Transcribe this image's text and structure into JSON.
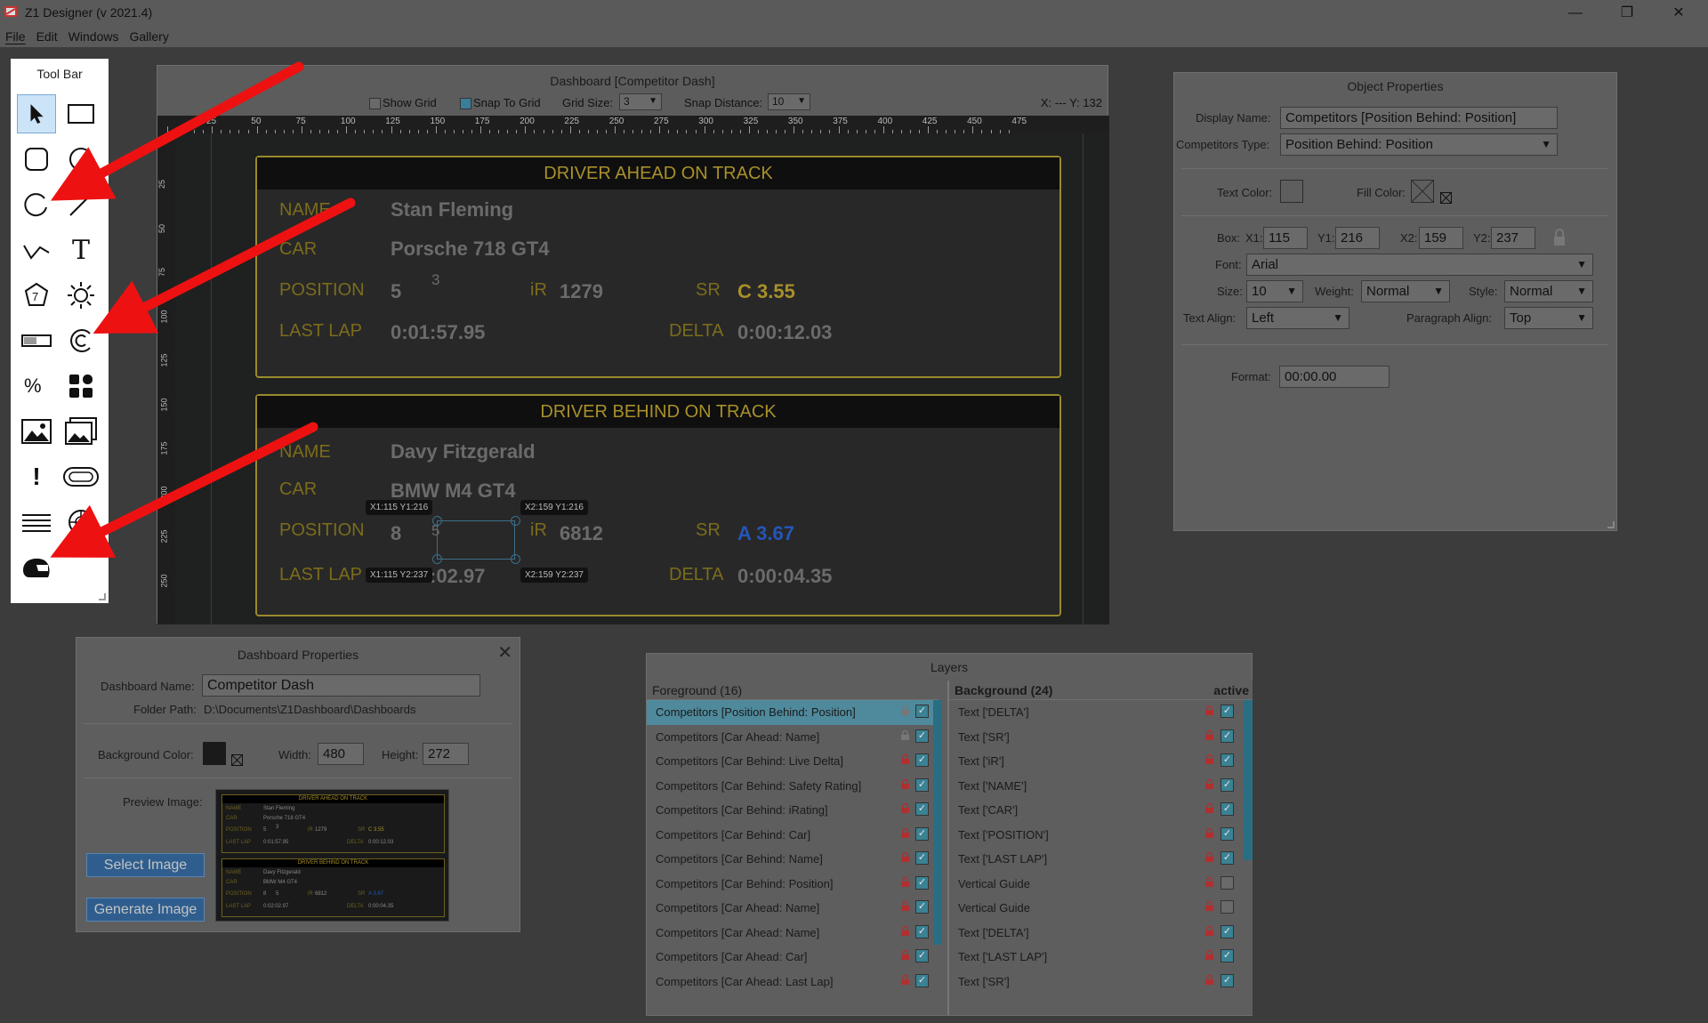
{
  "window": {
    "title": "Z1 Designer (v 2021.4)",
    "min": "—",
    "restore": "❐",
    "close": "✕"
  },
  "menu": [
    "File",
    "Edit",
    "Windows",
    "Gallery"
  ],
  "toolbar": {
    "title": "Tool Bar"
  },
  "dashboard": {
    "title": "Dashboard [Competitor Dash]",
    "show_grid": "Show Grid",
    "snap_to_grid": "Snap To Grid",
    "grid_size_label": "Grid Size:",
    "grid_size": "3",
    "snap_distance_label": "Snap Distance:",
    "snap_distance": "10",
    "coords": "X: --- Y: 132",
    "ruler_ticks": [
      "25",
      "50",
      "75",
      "100",
      "125",
      "150",
      "175",
      "200",
      "225",
      "250",
      "275",
      "300",
      "325",
      "350",
      "375",
      "400",
      "425",
      "450",
      "475"
    ],
    "vruler_ticks": [
      "25",
      "50",
      "75",
      "100",
      "125",
      "150",
      "175",
      "200",
      "225",
      "250"
    ],
    "ahead": {
      "header": "DRIVER AHEAD ON TRACK",
      "name_label": "NAME",
      "name": "Stan Fleming",
      "car_label": "CAR",
      "car": "Porsche 718 GT4",
      "position_label": "POSITION",
      "position": "5",
      "class_pos": "3",
      "ir_label": "iR",
      "ir": "1279",
      "sr_label": "SR",
      "sr": "C 3.55",
      "lastlap_label": "LAST LAP",
      "lastlap": "0:01:57.95",
      "delta_label": "DELTA",
      "delta": "0:00:12.03"
    },
    "behind": {
      "header": "DRIVER BEHIND ON TRACK",
      "name_label": "NAME",
      "name": "Davy Fitzgerald",
      "car_label": "CAR",
      "car": "BMW M4 GT4",
      "position_label": "POSITION",
      "position": "8",
      "class_pos": "5",
      "ir_label": "iR",
      "ir": "6812",
      "sr_label": "SR",
      "sr": "A 3.67",
      "lastlap_label": "LAST LAP",
      "lastlap": "0:02:02.97",
      "delta_label": "DELTA",
      "delta": "0:00:04.35"
    },
    "badges": {
      "tl": "X1:115 Y1:216",
      "tr": "X2:159 Y1:216",
      "bl": "X1:115 Y2:237",
      "br": "X2:159 Y2:237"
    }
  },
  "object_props": {
    "title": "Object Properties",
    "display_name_label": "Display Name:",
    "display_name": "Competitors [Position Behind: Position]",
    "type_label": "Competitors Type:",
    "type": "Position Behind: Position",
    "text_color_label": "Text Color:",
    "fill_color_label": "Fill Color:",
    "box_label": "Box:",
    "x1_label": "X1:",
    "x1": "115",
    "y1_label": "Y1:",
    "y1": "216",
    "x2_label": "X2:",
    "x2": "159",
    "y2_label": "Y2:",
    "y2": "237",
    "font_label": "Font:",
    "font": "Arial",
    "size_label": "Size:",
    "size": "10",
    "weight_label": "Weight:",
    "weight": "Normal",
    "style_label": "Style:",
    "style": "Normal",
    "text_align_label": "Text Align:",
    "text_align": "Left",
    "para_align_label": "Paragraph Align:",
    "para_align": "Top",
    "format_label": "Format:",
    "format": "00:00.00"
  },
  "dash_props": {
    "title": "Dashboard Properties",
    "name_label": "Dashboard Name:",
    "name": "Competitor Dash",
    "folder_label": "Folder Path:",
    "folder": "D:\\Documents\\Z1Dashboard\\Dashboards",
    "bg_label": "Background Color:",
    "width_label": "Width:",
    "width": "480",
    "height_label": "Height:",
    "height": "272",
    "preview_label": "Preview Image:",
    "select_btn": "Select Image",
    "generate_btn": "Generate Image",
    "preview": {
      "h1": "DRIVER AHEAD ON TRACK",
      "h2": "DRIVER BEHIND ON TRACK",
      "r1": [
        "NAME",
        "Stan Fleming"
      ],
      "r2": [
        "CAR",
        "Porsche 718 GT4"
      ],
      "r3": [
        "POSITION",
        "5",
        "3",
        "iR",
        "1279",
        "SR",
        "C 3.55"
      ],
      "r4": [
        "LAST LAP",
        "0:01:57.95",
        "DELTA",
        "0:00:12.03"
      ],
      "s1": [
        "NAME",
        "Davy Fitzgerald"
      ],
      "s2": [
        "CAR",
        "BMW M4 GT4"
      ],
      "s3": [
        "POSITION",
        "8",
        "5",
        "iR",
        "6812",
        "SR",
        "A 3.67"
      ],
      "s4": [
        "LAST LAP",
        "0:02:02.97",
        "DELTA",
        "0:00:04.35"
      ]
    }
  },
  "layers": {
    "title": "Layers",
    "fg_label": "Foreground (16)",
    "bg_label": "Background (24)",
    "active_label": "active",
    "foreground": [
      {
        "name": "Competitors [Position Behind: Position]",
        "locked": false,
        "checked": true,
        "selected": true
      },
      {
        "name": "Competitors [Car Ahead: Name]",
        "locked": false,
        "checked": true
      },
      {
        "name": "Competitors [Car Behind: Live Delta]",
        "locked": true,
        "checked": true
      },
      {
        "name": "Competitors [Car Behind: Safety Rating]",
        "locked": true,
        "checked": true
      },
      {
        "name": "Competitors [Car Behind: iRating]",
        "locked": true,
        "checked": true
      },
      {
        "name": "Competitors [Car Behind: Car]",
        "locked": true,
        "checked": true
      },
      {
        "name": "Competitors [Car Behind: Name]",
        "locked": true,
        "checked": true
      },
      {
        "name": "Competitors [Car Behind: Position]",
        "locked": true,
        "checked": true
      },
      {
        "name": "Competitors [Car Ahead: Name]",
        "locked": true,
        "checked": true
      },
      {
        "name": "Competitors [Car Ahead: Name]",
        "locked": true,
        "checked": true
      },
      {
        "name": "Competitors [Car Ahead: Car]",
        "locked": true,
        "checked": true
      },
      {
        "name": "Competitors [Car Ahead: Last Lap]",
        "locked": true,
        "checked": true
      }
    ],
    "background": [
      {
        "name": "Text ['DELTA']",
        "checked": true
      },
      {
        "name": "Text ['SR']",
        "checked": true
      },
      {
        "name": "Text ['iR']",
        "checked": true
      },
      {
        "name": "Text ['NAME']",
        "checked": true
      },
      {
        "name": "Text ['CAR']",
        "checked": true
      },
      {
        "name": "Text ['POSITION']",
        "checked": true
      },
      {
        "name": "Text ['LAST LAP']",
        "checked": true
      },
      {
        "name": "Vertical Guide",
        "checked": false
      },
      {
        "name": "Vertical Guide",
        "checked": false
      },
      {
        "name": "Text ['DELTA']",
        "checked": true
      },
      {
        "name": "Text ['LAST LAP']",
        "checked": true
      },
      {
        "name": "Text ['SR']",
        "checked": true
      }
    ]
  },
  "colors": {
    "accent_gold": "#a8902a",
    "sr_c": "#a8902a",
    "sr_a": "#2456b8",
    "arrow": "#ee1111",
    "selection": "#4f8a9c"
  }
}
